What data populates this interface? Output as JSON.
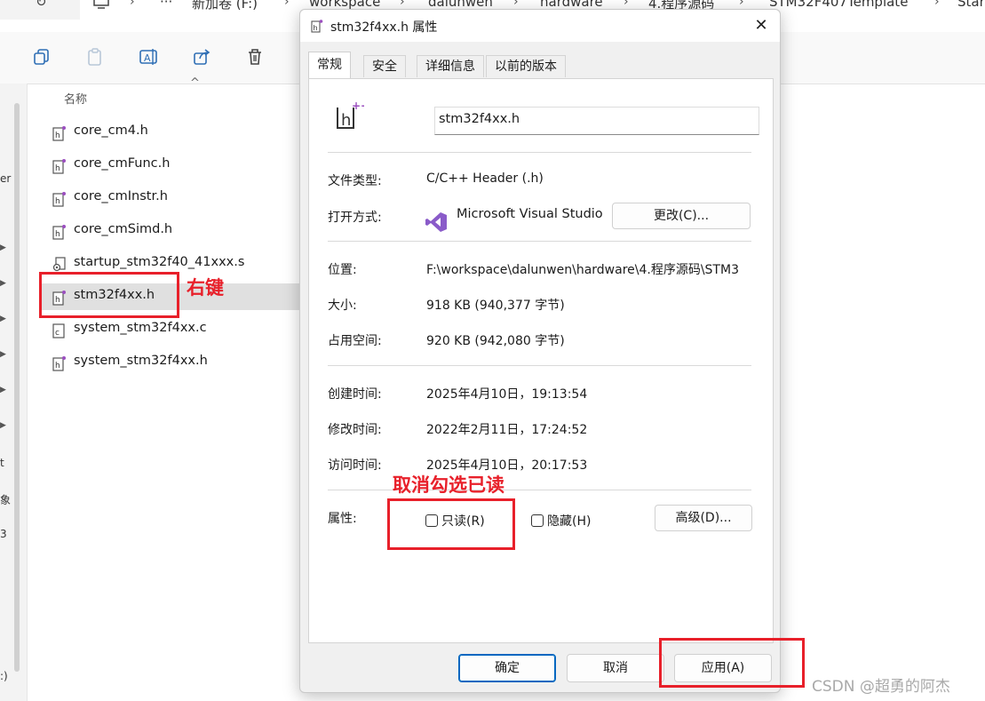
{
  "address_bar": {
    "crumbs": [
      "新加卷 (F:)",
      "workspace",
      "dalunwen",
      "hardware",
      "4.程序源码",
      "STM32F407Template",
      "Star"
    ],
    "more": "···"
  },
  "list": {
    "column_name": "名称",
    "files": [
      {
        "name": "core_cm4.h",
        "icon": "header-file-icon"
      },
      {
        "name": "core_cmFunc.h",
        "icon": "header-file-icon"
      },
      {
        "name": "core_cmInstr.h",
        "icon": "header-file-icon"
      },
      {
        "name": "core_cmSimd.h",
        "icon": "header-file-icon"
      },
      {
        "name": "startup_stm32f40_41xxx.s",
        "icon": "asm-file-icon"
      },
      {
        "name": "stm32f4xx.h",
        "icon": "header-file-icon",
        "selected": true
      },
      {
        "name": "system_stm32f4xx.c",
        "icon": "c-file-icon"
      },
      {
        "name": "system_stm32f4xx.h",
        "icon": "header-file-icon"
      }
    ]
  },
  "sidebar_fragments": [
    "er",
    "t",
    "象",
    "3",
    ":)"
  ],
  "annotations": {
    "right_click": "右键",
    "uncheck_readonly": "取消勾选已读",
    "accent_color": "#e8202a"
  },
  "dialog": {
    "title": "stm32f4xx.h 属性",
    "close": "✕",
    "tabs": [
      "常规",
      "安全",
      "详细信息",
      "以前的版本"
    ],
    "filename": "stm32f4xx.h",
    "file_type_label": "文件类型:",
    "file_type_value": "C/C++ Header (.h)",
    "open_with_label": "打开方式:",
    "open_with_value": "Microsoft Visual Studio",
    "change_button": "更改(C)...",
    "location_label": "位置:",
    "location_value": "F:\\workspace\\dalunwen\\hardware\\4.程序源码\\STM3",
    "size_label": "大小:",
    "size_value": "918 KB (940,377 字节)",
    "disk_size_label": "占用空间:",
    "disk_size_value": "920 KB (942,080 字节)",
    "created_label": "创建时间:",
    "created_value": "2025年4月10日，19:13:54",
    "modified_label": "修改时间:",
    "modified_value": "2022年2月11日，17:24:52",
    "accessed_label": "访问时间:",
    "accessed_value": "2025年4月10日，20:17:53",
    "attributes_label": "属性:",
    "readonly_label": "只读(R)",
    "readonly_checked": false,
    "hidden_label": "隐藏(H)",
    "hidden_checked": false,
    "advanced_button": "高级(D)...",
    "ok_button": "确定",
    "cancel_button": "取消",
    "apply_button": "应用(A)"
  },
  "watermark": "CSDN @超勇的阿杰"
}
